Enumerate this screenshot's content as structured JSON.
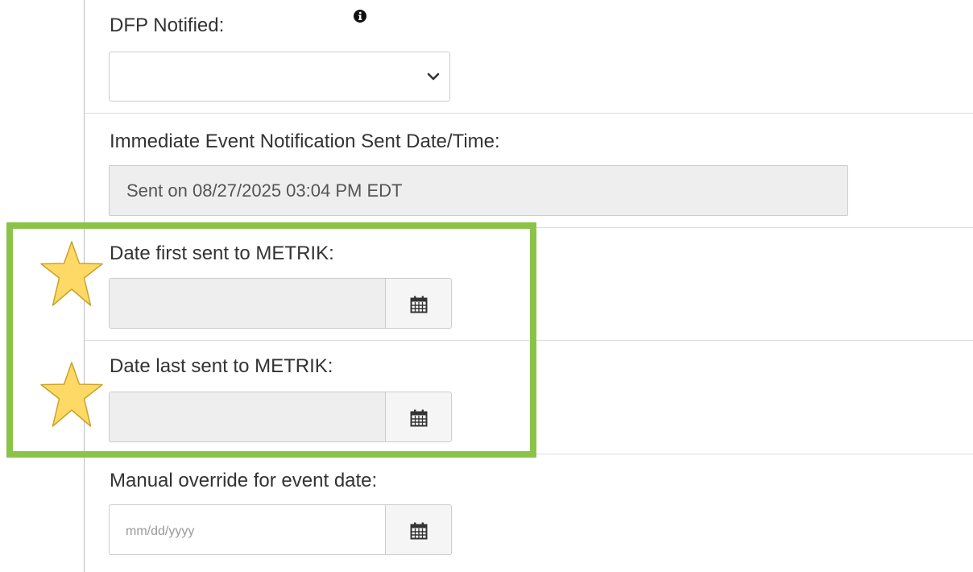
{
  "fields": {
    "dfp_notified": {
      "label": "DFP Notified:",
      "value": ""
    },
    "immediate_notification": {
      "label": "Immediate Event Notification Sent Date/Time:",
      "value": "Sent on 08/27/2025 03:04 PM EDT"
    },
    "date_first_sent": {
      "label": "Date first sent to METRIK:",
      "value": ""
    },
    "date_last_sent": {
      "label": "Date last sent to METRIK:",
      "value": ""
    },
    "manual_override": {
      "label": "Manual override for event date:",
      "placeholder": "mm/dd/yyyy"
    }
  },
  "icons": {
    "info": "info-icon",
    "dropdown": "chevron-down-icon",
    "calendar": "calendar-icon",
    "star": "star-icon"
  },
  "colors": {
    "highlight": "#8bc34a",
    "star_fill": "#ffd966",
    "star_stroke": "#c9a227"
  }
}
